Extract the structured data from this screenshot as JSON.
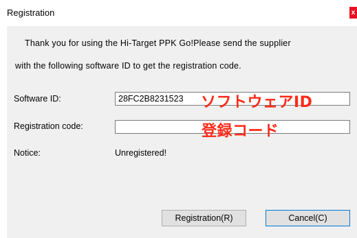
{
  "window": {
    "title": "Registration",
    "close_glyph": "x",
    "close_color": "#e81123"
  },
  "message": {
    "line1": "Thank you for using the Hi-Target PPK Go!Please send the supplier",
    "line2": "with the following software ID to get the registration code."
  },
  "software_id": {
    "label": "Software ID:",
    "value": "28FC2B8231523",
    "annotation": "ソフトウェアID"
  },
  "registration_code": {
    "label": "Registration code:",
    "value": "",
    "annotation": "登録コード"
  },
  "notice": {
    "label": "Notice:",
    "value": "Unregistered!"
  },
  "buttons": {
    "register_label": "Registration(R)",
    "cancel_label": "Cancel(C)"
  },
  "colors": {
    "annotation": "#ff2a1a",
    "client_bg": "#f0f0f0",
    "focus_border": "#0078d7"
  }
}
